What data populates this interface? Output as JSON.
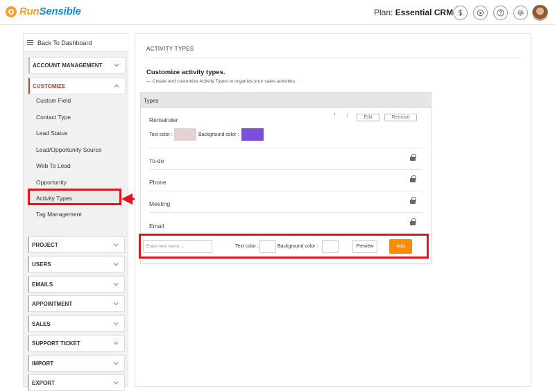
{
  "brand": {
    "part1": "Run",
    "part2": "Sensible"
  },
  "plan": {
    "label": "Plan:",
    "name": "Essential CRM"
  },
  "topbar_icons": [
    "dollar-icon",
    "dashboard-icon",
    "help-icon",
    "settings-icon"
  ],
  "sidebar": {
    "back_label": "Back To Dashboard",
    "sections": [
      {
        "label": "ACCOUNT MANAGEMENT",
        "expanded": false
      },
      {
        "label": "CUSTOMIZE",
        "expanded": true
      },
      {
        "label": "PROJECT",
        "expanded": false
      },
      {
        "label": "USERS",
        "expanded": false
      },
      {
        "label": "EMAILS",
        "expanded": false
      },
      {
        "label": "APPOINTMENT",
        "expanded": false
      },
      {
        "label": "SALES",
        "expanded": false
      },
      {
        "label": "SUPPORT TICKET",
        "expanded": false
      },
      {
        "label": "IMPORT",
        "expanded": false
      },
      {
        "label": "EXPORT",
        "expanded": false
      }
    ],
    "customize_items": [
      "Custom Field",
      "Contact Type",
      "Lead Status",
      "Lead/Opportunity Source",
      "Web To Lead",
      "Opportunity",
      "Activity Types",
      "Tag Management"
    ],
    "selected_item": "Activity Types"
  },
  "main": {
    "title": "ACTIVITY TYPES",
    "heading": "Customize activity types.",
    "description": "—  Create and customize Activity Types to organize your sales activities.",
    "types_header": "Types",
    "rows": [
      {
        "label": "Remainder",
        "editable": true
      },
      {
        "label": "To-do",
        "locked": true
      },
      {
        "label": "Phone",
        "locked": true
      },
      {
        "label": "Meeting",
        "locked": true
      },
      {
        "label": "Email",
        "locked": true
      }
    ],
    "edit_label": "Edit",
    "remove_label": "Remove",
    "up_arrow": "↑",
    "down_arrow": "↓",
    "text_color_label": "Text color :",
    "bg_color_label": "Background color :",
    "remainder_text_color": "#e3d2d2",
    "remainder_bg_color": "#7b4fd8",
    "new_name_placeholder": "Enter new name ...",
    "new_text_color_label": "Text color :",
    "new_bg_color_label": "Background color :",
    "preview_label": "Preview",
    "add_label": "Add"
  },
  "colors": {
    "accent_orange": "#fd8c00",
    "highlight_red": "#e0141a",
    "brand_orange": "#f7a021",
    "brand_blue": "#1b8ad6"
  }
}
